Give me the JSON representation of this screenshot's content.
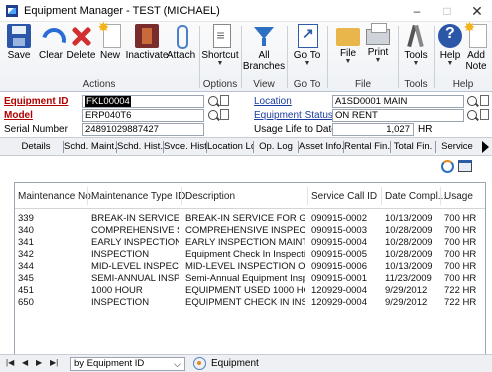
{
  "window": {
    "title": "Equipment Manager  -  TEST (MICHAEL)",
    "min": "–",
    "max": "□",
    "close": "✕"
  },
  "ribbon": {
    "buttons": [
      {
        "label": "Save",
        "icon": "save-icon"
      },
      {
        "label": "Clear",
        "icon": "clear-icon"
      },
      {
        "label": "Delete",
        "icon": "delete-icon"
      },
      {
        "label": "New",
        "icon": "new-icon"
      },
      {
        "label": "Inactivate",
        "icon": "inactivate-icon"
      },
      {
        "label": "Attach",
        "icon": "attach-icon"
      },
      {
        "label": "Shortcut",
        "icon": "shortcut-icon"
      },
      {
        "label": "All Branches",
        "icon": "filter-icon"
      },
      {
        "label": "Go To",
        "icon": "goto-icon"
      },
      {
        "label": "File",
        "icon": "file-icon"
      },
      {
        "label": "Print",
        "icon": "print-icon"
      },
      {
        "label": "Tools",
        "icon": "tools-icon"
      },
      {
        "label": "Help",
        "icon": "help-icon"
      },
      {
        "label": "Add Note",
        "icon": "note-icon"
      }
    ],
    "groups": [
      "Actions",
      "Options",
      "View",
      "Go To",
      "File",
      "Tools",
      "Help"
    ]
  },
  "form": {
    "equipment_id_label": "Equipment ID",
    "equipment_id_value": "FKL00004",
    "model_label": "Model",
    "model_value": "ERP040T6",
    "serial_label": "Serial Number",
    "serial_value": "24891029887427",
    "location_label": "Location",
    "location_value": "A1SD0001 MAIN",
    "status_label": "Equipment Status",
    "status_value": "ON RENT",
    "usage_label": "Usage Life to Date",
    "usage_value": "1,027",
    "usage_unit": "HR"
  },
  "tabs": [
    "Details",
    "Schd. Maint.",
    "Schd. Hist.",
    "Svce. Hist.",
    "Location Log",
    "Op. Log",
    "Asset Info.",
    "Rental Fin.",
    "Total Fin.",
    "Service"
  ],
  "grid": {
    "columns": [
      "Maintenance No.",
      "Maintenance Type ID",
      "Description",
      "Service Call ID",
      "Date Compl...",
      "Usage"
    ],
    "rows": [
      [
        "339",
        "BREAK-IN SERVICE",
        "BREAK-IN SERVICE FOR GENER...",
        "090915-0002",
        "10/13/2009",
        "700 HR"
      ],
      [
        "340",
        "COMPREHENSIVE SER...",
        "COMPREHENSIVE INSPECTION...",
        "090915-0003",
        "10/28/2009",
        "700 HR"
      ],
      [
        "341",
        "EARLY INSPECTION",
        "EARLY INSPECTION MAINTEN...",
        "090915-0004",
        "10/28/2009",
        "700 HR"
      ],
      [
        "342",
        "INSPECTION",
        "Equipment Check In Inspection",
        "090915-0005",
        "10/28/2009",
        "700 HR"
      ],
      [
        "344",
        "MID-LEVEL INSPECTION",
        "MID-LEVEL INSPECTION OF GE...",
        "090915-0006",
        "10/13/2009",
        "700 HR"
      ],
      [
        "345",
        "SEMI-ANNUAL INSPE...",
        "Semi-Annual Equipment Inspe...",
        "090915-0001",
        "11/23/2009",
        "700 HR"
      ],
      [
        "451",
        "1000 HOUR",
        "EQUIPMENT USED 1000 HOURS",
        "120929-0004",
        "9/29/2012",
        "722 HR"
      ],
      [
        "650",
        "INSPECTION",
        "EQUIPMENT CHECK IN INSPEC...",
        "120929-0004",
        "9/29/2012",
        "722 HR"
      ]
    ]
  },
  "footer": {
    "nav_first": "|◀",
    "nav_prev": "◀",
    "nav_next": "▶",
    "nav_last": "▶|",
    "sort_value": "by Equipment ID",
    "sort_caret": "⌵",
    "equipment_label": "Equipment"
  }
}
